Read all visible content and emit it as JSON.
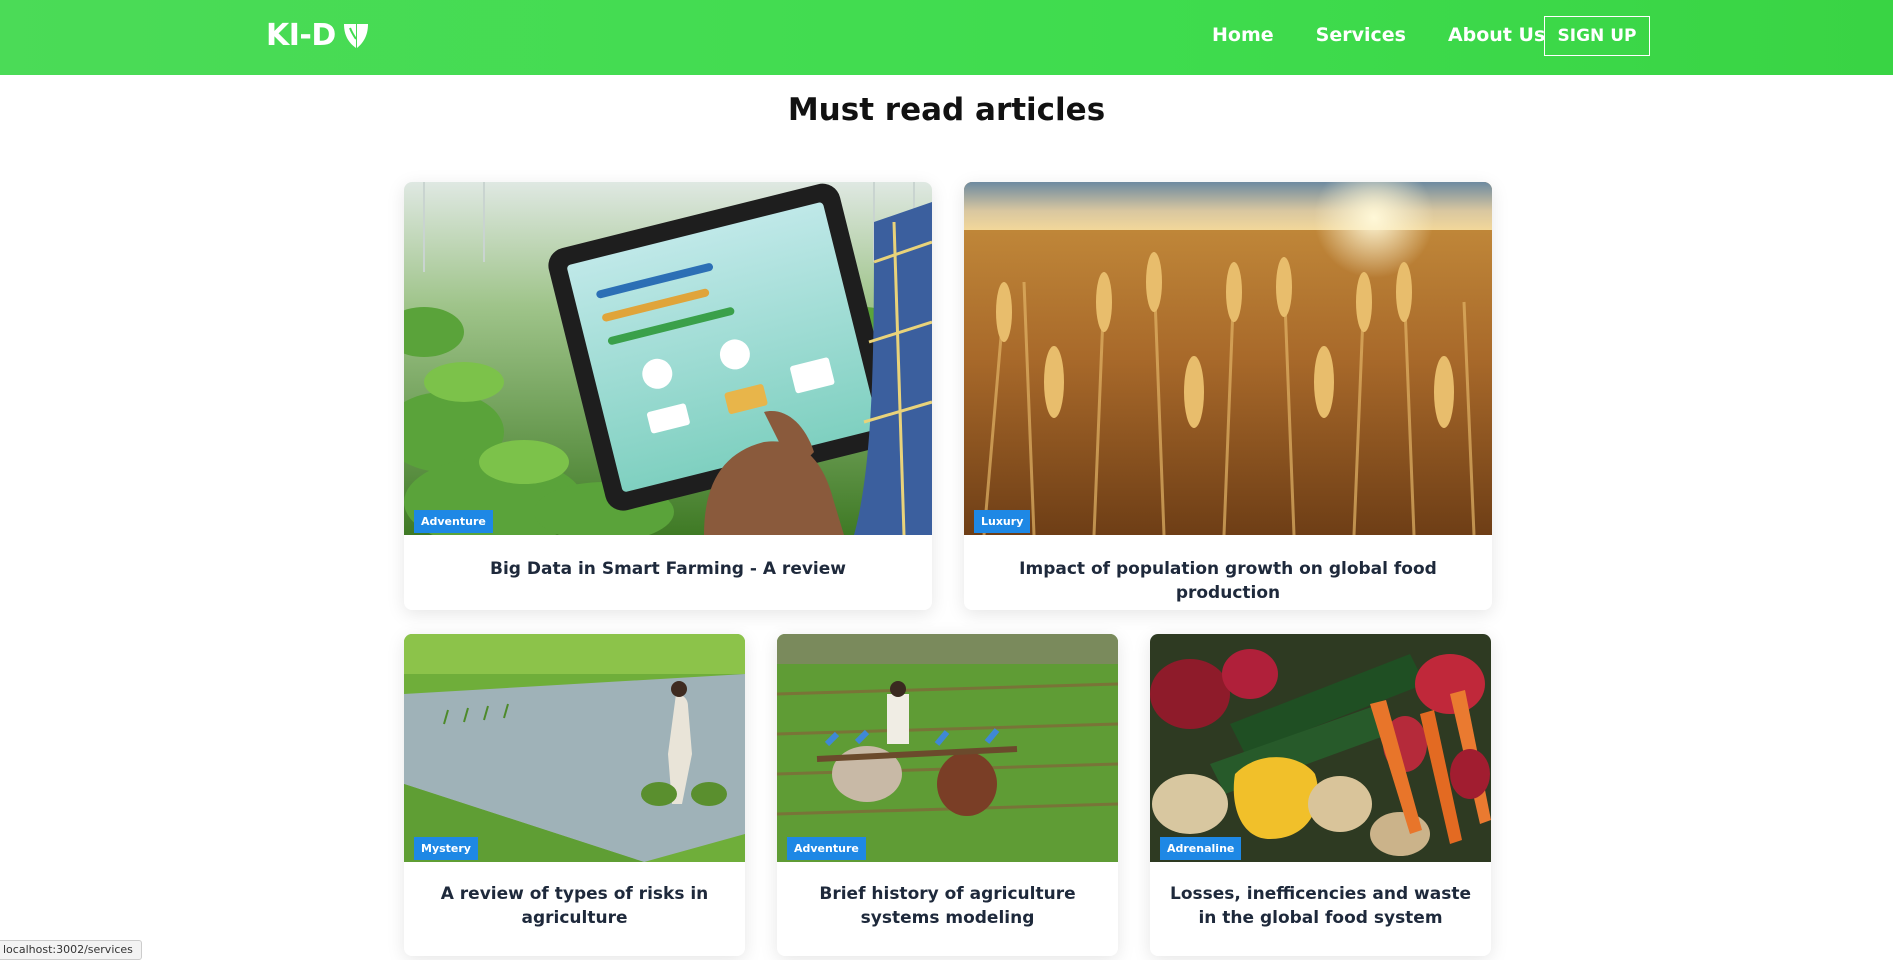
{
  "header": {
    "logo_text": "KI-D",
    "logo_icon": "shield-leaf-icon",
    "nav": [
      "Home",
      "Services",
      "About Us"
    ],
    "signup_label": "SIGN UP"
  },
  "main": {
    "heading": "Must read articles",
    "articles": [
      {
        "tag": "Adventure",
        "title": "Big Data in Smart Farming - A review",
        "image": "tablet-in-greenhouse"
      },
      {
        "tag": "Luxury",
        "title": "Impact of population growth on global food production",
        "image": "wheat-field-sunset"
      },
      {
        "tag": "Mystery",
        "title": "A review of types of risks in agriculture",
        "image": "rice-paddy-farmer"
      },
      {
        "tag": "Adventure",
        "title": "Brief history of agriculture systems modeling",
        "image": "oxen-plowing-field"
      },
      {
        "tag": "Adrenaline",
        "title": "Losses, inefficencies and waste in the global food system",
        "image": "vegetables-closeup"
      }
    ]
  },
  "status_bar": {
    "url": "localhost:3002/services"
  },
  "colors": {
    "header_green": "#3fdc4e",
    "tag_blue": "#1e88e5"
  }
}
